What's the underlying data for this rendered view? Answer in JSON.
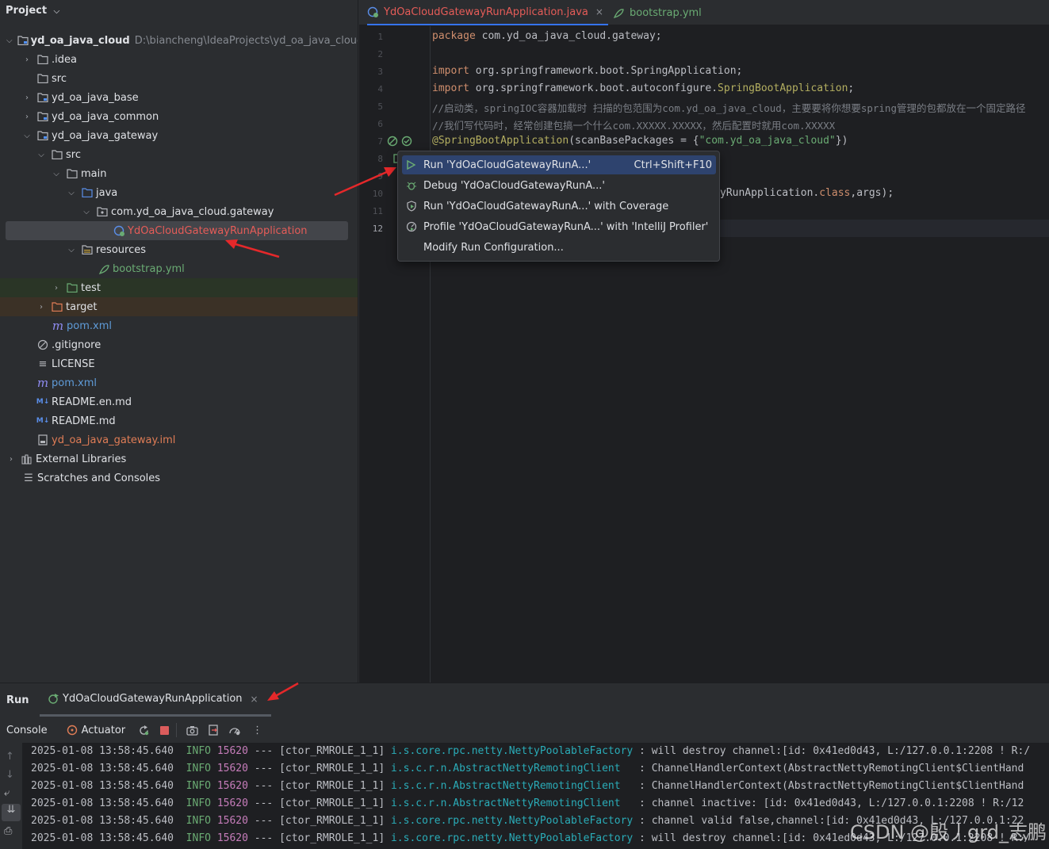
{
  "project_panel": {
    "title": "Project",
    "tree": [
      {
        "label": "yd_oa_java_cloud",
        "hint": "D:\\biancheng\\IdeaProjects\\yd_oa_java_cloud",
        "icon": "module-folder-icon"
      },
      {
        "label": ".idea",
        "icon": "folder-icon"
      },
      {
        "label": "src",
        "icon": "folder-icon"
      },
      {
        "label": "yd_oa_java_base",
        "icon": "module-folder-icon"
      },
      {
        "label": "yd_oa_java_common",
        "icon": "module-folder-icon"
      },
      {
        "label": "yd_oa_java_gateway",
        "icon": "module-folder-icon"
      },
      {
        "label": "src",
        "icon": "folder-icon"
      },
      {
        "label": "main",
        "icon": "folder-icon"
      },
      {
        "label": "java",
        "icon": "source-folder-icon"
      },
      {
        "label": "com.yd_oa_java_cloud.gateway",
        "icon": "package-icon"
      },
      {
        "label": "YdOaCloudGatewayRunApplication",
        "icon": "spring-boot-class-icon"
      },
      {
        "label": "resources",
        "icon": "resources-folder-icon"
      },
      {
        "label": "bootstrap.yml",
        "icon": "yaml-icon"
      },
      {
        "label": "test",
        "icon": "test-folder-icon"
      },
      {
        "label": "target",
        "icon": "excluded-folder-icon"
      },
      {
        "label": "pom.xml",
        "icon": "maven-icon"
      },
      {
        "label": ".gitignore",
        "icon": "gitignore-icon"
      },
      {
        "label": "LICENSE",
        "icon": "text-file-icon"
      },
      {
        "label": "pom.xml",
        "icon": "maven-icon"
      },
      {
        "label": "README.en.md",
        "icon": "markdown-icon"
      },
      {
        "label": "README.md",
        "icon": "markdown-icon"
      },
      {
        "label": "yd_oa_java_gateway.iml",
        "icon": "iml-file-icon"
      },
      {
        "label": "External Libraries",
        "icon": "library-icon"
      },
      {
        "label": "Scratches and Consoles",
        "icon": "scratches-icon"
      }
    ]
  },
  "editor": {
    "tabs": [
      {
        "label": "YdOaCloudGatewayRunApplication.java",
        "close": "×"
      },
      {
        "label": "bootstrap.yml"
      }
    ],
    "line_numbers": [
      "1",
      "2",
      "3",
      "4",
      "5",
      "6",
      "7",
      "8",
      "9",
      "10",
      "11",
      "12"
    ],
    "code": {
      "l1_kw": "package",
      "l1_rest": " com.yd_oa_java_cloud.gateway;",
      "l3_kw": "import",
      "l3_rest": " org.springframework.boot.SpringApplication;",
      "l4_kw": "import",
      "l4_rest": " org.springframework.boot.autoconfigure.",
      "l4_ann": "SpringBootApplication",
      "l4_end": ";",
      "l5": "//启动类，springIOC容器加载时 扫描的包范围为com.yd_oa_java_cloud，主要要将你想要spring管理的包都放在一个固定路径",
      "l6": "//我们写代码时，经常创建包搞一个什么com.XXXXX.XXXXX，然后配置时就用com.XXXXX",
      "l7_ann": "@SpringBootApplication",
      "l7_rest": "(scanBasePackages = {",
      "l7_str": "\"com.yd_oa_java_cloud\"",
      "l7_end": "})",
      "l10_a": "yRunApplication.",
      "l10_kw": "class",
      "l10_b": ",args);"
    }
  },
  "context_menu": {
    "items": [
      {
        "label": "Run 'YdOaCloudGatewayRunA...'",
        "shortcut": "Ctrl+Shift+F10"
      },
      {
        "label": "Debug 'YdOaCloudGatewayRunA...'"
      },
      {
        "label": "Run 'YdOaCloudGatewayRunA...' with Coverage"
      },
      {
        "label": "Profile 'YdOaCloudGatewayRunA...' with 'IntelliJ Profiler'"
      },
      {
        "label": "Modify Run Configuration..."
      }
    ]
  },
  "run_panel": {
    "title": "Run",
    "tab_label": "YdOaCloudGatewayRunApplication",
    "tab_close": "×",
    "toolbar": {
      "console": "Console",
      "actuator": "Actuator",
      "more": "⋮"
    },
    "logs": [
      {
        "ts": "2025-01-08 13:58:45.640",
        "level": "INFO",
        "pid": "15620",
        "sep": "---",
        "thread": "[ctor_RMROLE_1_1]",
        "logger": "i.s.core.rpc.netty.NettyPoolableFactory",
        "msg": " : will destroy channel:[id: 0x41ed0d43, L:/127.0.0.1:2208 ! R:/"
      },
      {
        "ts": "2025-01-08 13:58:45.640",
        "level": "INFO",
        "pid": "15620",
        "sep": "---",
        "thread": "[ctor_RMROLE_1_1]",
        "logger": "i.s.c.r.n.AbstractNettyRemotingClient  ",
        "msg": " : ChannelHandlerContext(AbstractNettyRemotingClient$ClientHand"
      },
      {
        "ts": "2025-01-08 13:58:45.640",
        "level": "INFO",
        "pid": "15620",
        "sep": "---",
        "thread": "[ctor_RMROLE_1_1]",
        "logger": "i.s.c.r.n.AbstractNettyRemotingClient  ",
        "msg": " : ChannelHandlerContext(AbstractNettyRemotingClient$ClientHand"
      },
      {
        "ts": "2025-01-08 13:58:45.640",
        "level": "INFO",
        "pid": "15620",
        "sep": "---",
        "thread": "[ctor_RMROLE_1_1]",
        "logger": "i.s.c.r.n.AbstractNettyRemotingClient  ",
        "msg": " : channel inactive: [id: 0x41ed0d43, L:/127.0.0.1:2208 ! R:/12"
      },
      {
        "ts": "2025-01-08 13:58:45.640",
        "level": "INFO",
        "pid": "15620",
        "sep": "---",
        "thread": "[ctor_RMROLE_1_1]",
        "logger": "i.s.core.rpc.netty.NettyPoolableFactory",
        "msg": " : channel valid false,channel:[id: 0x41ed0d43, L:/127.0.0.1:22"
      },
      {
        "ts": "2025-01-08 13:58:45.640",
        "level": "INFO",
        "pid": "15620",
        "sep": "---",
        "thread": "[ctor_RMROLE_1_1]",
        "logger": "i.s.core.rpc.netty.NettyPoolableFactory",
        "msg": " : will destroy channel:[id: 0x41ed0d43, L:/127.0.0.1:2208 ! R:/"
      }
    ]
  },
  "watermark": "CSDN @殷丿grd_志鹏",
  "colors": {
    "accent": "#3574f0",
    "annotation_arrow": "#e5282a",
    "selection": "#2e436e"
  }
}
